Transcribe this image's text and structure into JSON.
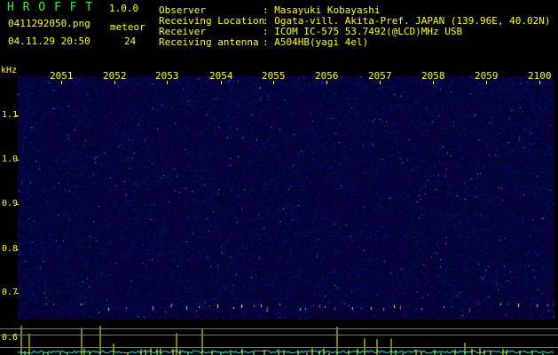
{
  "header": {
    "title": "H R O F F T",
    "version": "1.0.0",
    "filename": "0411292050.png",
    "timestamp": "04.11.29 20:50",
    "meteor_label": "meteor",
    "meteor_count": "24",
    "info": [
      {
        "label": "Observer",
        "value": ": Masayuki Kobayashi"
      },
      {
        "label": "Receiving Location",
        "value": ": Ogata-vill. Akita-Pref. JAPAN (139.96E, 40.02N)"
      },
      {
        "label": "Receiver",
        "value": ": ICOM IC-575 53.7492(@LCD)MHz USB"
      },
      {
        "label": "Receiving antenna",
        "value": ": A504HB(yagi 4el)"
      }
    ]
  },
  "axes": {
    "y_unit": "kHz",
    "y_labels": [
      "1.1",
      "1.0",
      "0.9",
      "0.8",
      "0.7",
      "0.6"
    ],
    "x_labels": [
      "2051",
      "2052",
      "2053",
      "2054",
      "2055",
      "2056",
      "2057",
      "2058",
      "2059",
      "2100"
    ]
  },
  "colors": {
    "background": "#030338",
    "text": "#ffff00",
    "title": "#33ee33",
    "signal": "#ffff00",
    "noise_floor": "#00e0e0"
  }
}
